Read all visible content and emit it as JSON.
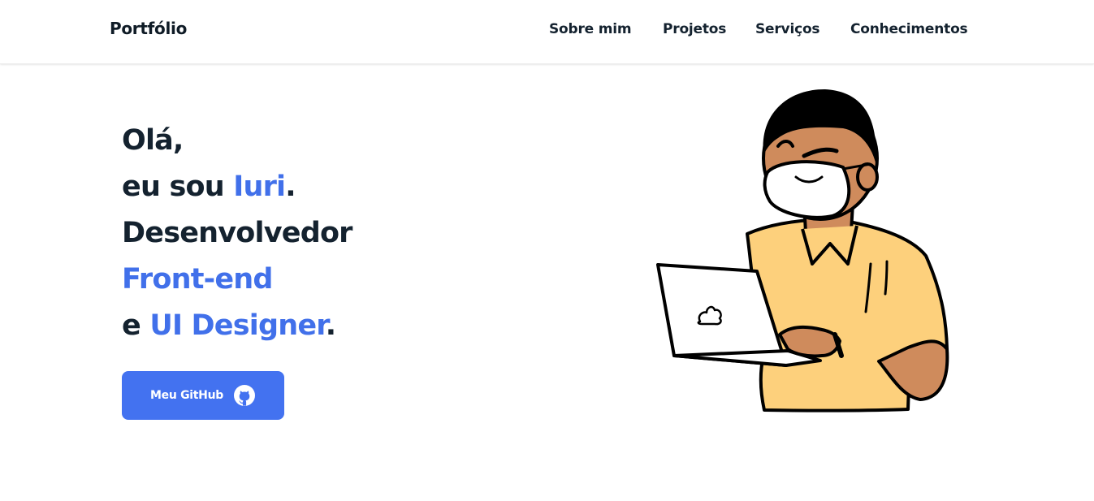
{
  "header": {
    "brand": "Portfólio",
    "nav": [
      {
        "label": "Sobre mim"
      },
      {
        "label": "Projetos"
      },
      {
        "label": "Serviços"
      },
      {
        "label": "Conhecimentos"
      }
    ]
  },
  "hero": {
    "greeting": "Olá,",
    "intro_prefix": "eu sou ",
    "name": "Iuri",
    "intro_suffix": ".",
    "role": "Desenvolvedor",
    "role_accent": "Front-end",
    "conj": "e ",
    "role2_accent": "UI Designer",
    "role2_suffix": "."
  },
  "cta": {
    "label": "Meu GitHub",
    "icon": "github-icon"
  },
  "illustration": {
    "subject": "person-with-laptop-icon"
  },
  "colors": {
    "accent": "#4170ea",
    "button": "#4372f0",
    "text": "#14222f",
    "shirt": "#fdd07c",
    "skin": "#cf8b5c"
  }
}
